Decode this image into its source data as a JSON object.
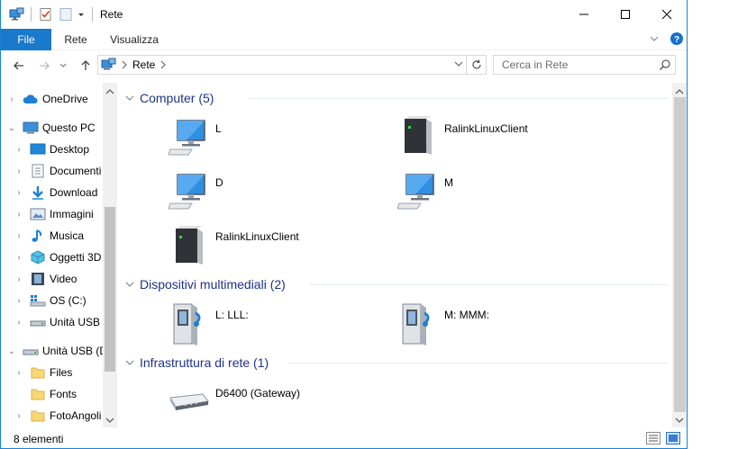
{
  "window": {
    "title": "Rete",
    "controls": {
      "minimize": "—",
      "maximize": "☐",
      "close": "✕"
    }
  },
  "ribbon": {
    "tabs": [
      {
        "label": "File",
        "active": true
      },
      {
        "label": "Rete"
      },
      {
        "label": "Visualizza"
      }
    ]
  },
  "address": {
    "location": "Rete",
    "search_placeholder": "Cerca in Rete"
  },
  "navpane": {
    "items": [
      {
        "label": "OneDrive",
        "icon": "onedrive-icon"
      },
      {
        "label": "Questo PC",
        "icon": "computer-icon"
      },
      {
        "label": "Desktop",
        "icon": "desktop-folder-icon"
      },
      {
        "label": "Documenti",
        "icon": "documents-folder-icon"
      },
      {
        "label": "Download",
        "icon": "download-folder-icon"
      },
      {
        "label": "Immagini",
        "icon": "pictures-folder-icon"
      },
      {
        "label": "Musica",
        "icon": "music-folder-icon"
      },
      {
        "label": "Oggetti 3D",
        "icon": "objects-3d-folder-icon"
      },
      {
        "label": "Video",
        "icon": "video-folder-icon"
      },
      {
        "label": "OS (C:)",
        "icon": "system-drive-icon"
      },
      {
        "label": "Unità USB (",
        "icon": "usb-drive-icon"
      },
      {
        "label": "Unità USB (D",
        "icon": "usb-drive-icon"
      },
      {
        "label": "Files",
        "icon": "folder-icon"
      },
      {
        "label": "Fonts",
        "icon": "folder-icon"
      },
      {
        "label": "FotoAngoli",
        "icon": "folder-icon"
      }
    ]
  },
  "groups": [
    {
      "header": "Computer (5)",
      "items": [
        {
          "label": "L",
          "icon": "monitor-icon"
        },
        {
          "label": "RalinkLinuxClient",
          "icon": "server-icon"
        },
        {
          "label": "D",
          "icon": "monitor-icon"
        },
        {
          "label": "M",
          "icon": "monitor-icon"
        },
        {
          "label": "RalinkLinuxClient",
          "icon": "server-icon"
        }
      ]
    },
    {
      "header": "Dispositivi multimediali (2)",
      "items": [
        {
          "label": "L: LLL:",
          "icon": "media-server-icon"
        },
        {
          "label": "M: MMM:",
          "icon": "media-server-icon"
        }
      ]
    },
    {
      "header": "Infrastruttura di rete (1)",
      "items": [
        {
          "label": "D6400 (Gateway)",
          "icon": "router-icon"
        }
      ]
    }
  ],
  "status": {
    "count": "8 elementi"
  },
  "colors": {
    "accent": "#1979ca",
    "group_header": "#1e3287"
  }
}
